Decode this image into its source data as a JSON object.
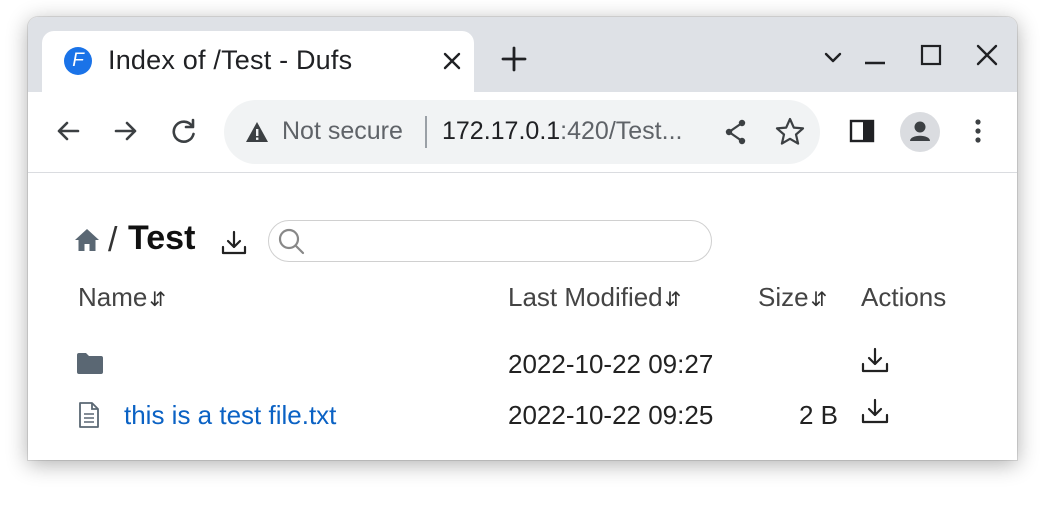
{
  "browser": {
    "tab": {
      "title": "Index of /Test - Dufs",
      "favicon_letter": "F"
    },
    "omnibox": {
      "security_label": "Not secure",
      "url_host": "172.17.0.1",
      "url_rest": ":420/Test..."
    },
    "icons": {
      "back": "arrow-left-icon",
      "forward": "arrow-right-icon",
      "reload": "reload-icon",
      "share": "share-icon",
      "bookmark": "star-icon",
      "side_panel": "side-panel-icon",
      "profile": "profile-icon",
      "menu": "kebab-menu-icon"
    }
  },
  "page": {
    "breadcrumb": {
      "separator": "/",
      "current_dir": "Test"
    },
    "search": {
      "value": "",
      "placeholder": ""
    },
    "table": {
      "headers": {
        "name": "Name",
        "last_modified": "Last Modified",
        "size": "Size",
        "actions": "Actions"
      },
      "sort_glyph": "⇵",
      "rows": [
        {
          "type": "folder",
          "name": "",
          "modified": "2022-10-22 09:27",
          "size": ""
        },
        {
          "type": "file",
          "name": "this is a test file.txt",
          "modified": "2022-10-22 09:25",
          "size": "2 B"
        }
      ]
    }
  },
  "colors": {
    "accent": "#1a73e8",
    "link": "#0b62c4",
    "tabstrip": "#dee1e6",
    "omnibox": "#f1f3f4",
    "icon": "#5f6368"
  }
}
